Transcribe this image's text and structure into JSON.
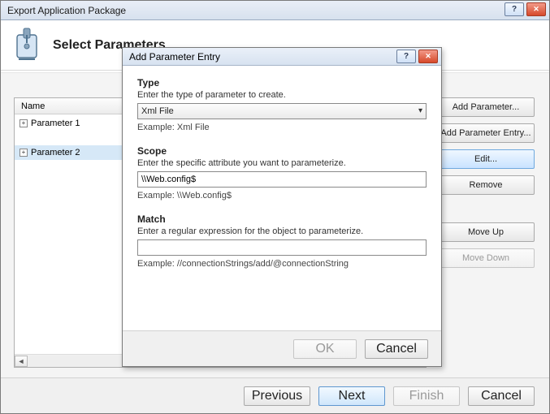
{
  "outer": {
    "title": "Export Application Package",
    "headline": "Select Parameters",
    "listHeader": "Name",
    "items": [
      "Parameter 1",
      "Parameter 2"
    ],
    "side": {
      "addParam": "Add Parameter...",
      "addEntry": "Add Parameter Entry...",
      "edit": "Edit...",
      "remove": "Remove",
      "moveUp": "Move Up",
      "moveDown": "Move Down"
    },
    "footer": {
      "prev": "Previous",
      "next": "Next",
      "finish": "Finish",
      "cancel": "Cancel"
    }
  },
  "modal": {
    "title": "Add Parameter Entry",
    "type": {
      "label": "Type",
      "desc": "Enter the type of parameter to create.",
      "value": "Xml File",
      "example": "Example: Xml File"
    },
    "scope": {
      "label": "Scope",
      "desc": "Enter the specific attribute you want to parameterize.",
      "value": "\\\\Web.config$",
      "example": "Example: \\\\Web.config$"
    },
    "match": {
      "label": "Match",
      "desc": "Enter a regular expression for the object to parameterize.",
      "value": "",
      "example": "Example: //connectionStrings/add/@connectionString"
    },
    "footer": {
      "ok": "OK",
      "cancel": "Cancel"
    }
  }
}
